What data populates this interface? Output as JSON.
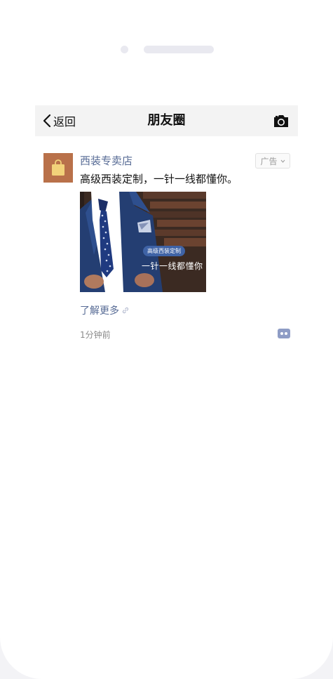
{
  "nav": {
    "back_label": "返回",
    "title": "朋友圈"
  },
  "post": {
    "author": "西装专卖店",
    "ad_label": "广告",
    "text": "高级西装定制，一针一线都懂你。",
    "image_tag": "高级西装定制",
    "image_caption": "一针一线都懂你",
    "learn_more": "了解更多",
    "time": "1分钟前"
  },
  "colors": {
    "link": "#576b95",
    "avatar_bg": "#b9714a",
    "nav_bg": "#f3f3f3",
    "image_tag_bg": "#3f63a6"
  }
}
